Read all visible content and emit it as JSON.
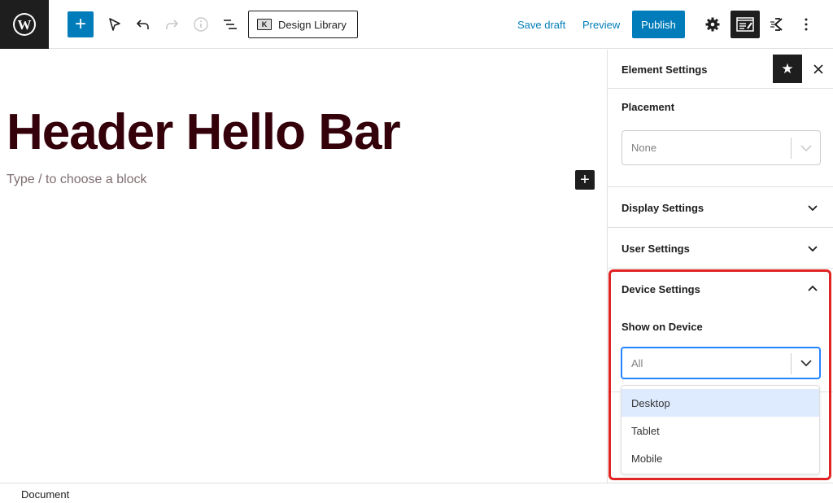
{
  "topbar": {
    "logo": "wordpress-logo",
    "add_block_label": "+",
    "tools": [
      "select-tool-icon",
      "undo-icon",
      "redo-icon",
      "info-icon",
      "list-view-icon"
    ],
    "design_library_label": "Design Library",
    "save_draft_label": "Save draft",
    "preview_label": "Preview",
    "publish_label": "Publish",
    "right_icons": [
      "settings-icon",
      "element-settings-icon",
      "kadence-icon",
      "more-options-icon"
    ]
  },
  "editor": {
    "title": "Header Hello Bar",
    "placeholder": "Type / to choose a block",
    "inline_add_label": "+"
  },
  "sidebar": {
    "title": "Element Settings",
    "placement": {
      "label": "Placement",
      "value": "None"
    },
    "panels": [
      {
        "label": "Display Settings",
        "expanded": false
      },
      {
        "label": "User Settings",
        "expanded": false
      },
      {
        "label": "Device Settings",
        "expanded": true
      }
    ],
    "device": {
      "label": "Show on Device",
      "value": "All",
      "options": [
        "Desktop",
        "Tablet",
        "Mobile"
      ],
      "highlighted": "Desktop"
    }
  },
  "footer": {
    "breadcrumb": "Document"
  },
  "colors": {
    "accent": "#007cba",
    "title": "#34000a",
    "highlight_border": "#e02424",
    "option_hover": "#deebff"
  }
}
